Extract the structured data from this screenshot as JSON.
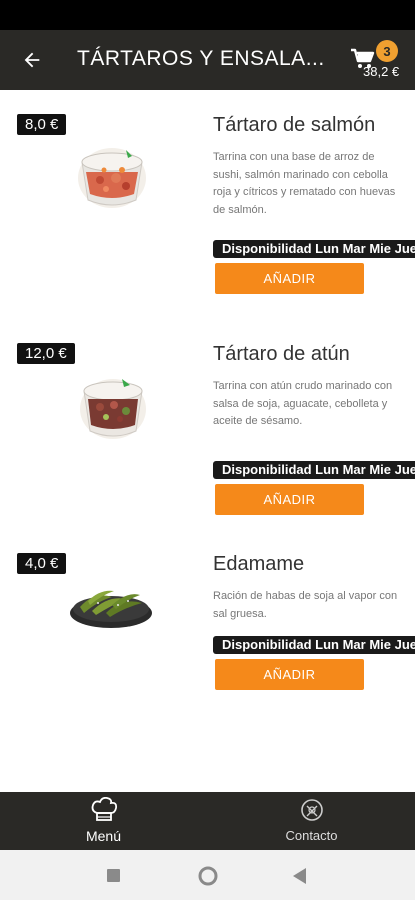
{
  "header": {
    "title": "TÁRTAROS Y ENSALA...",
    "cart_count": "3",
    "cart_total": "38,2 €"
  },
  "items": [
    {
      "price": "8,0 €",
      "name": "Tártaro de salmón",
      "description": "Tarrina con una base de arroz de sushi, salmón marinado con cebolla roja y cítricos y rematado con huevas de salmón.",
      "availability": "Disponibilidad Lun Mar Mie Jue Vie Sab Dom",
      "add_label": "AÑADIR"
    },
    {
      "price": "12,0 €",
      "name": "Tártaro de atún",
      "description": "Tarrina con atún crudo marinado con salsa de soja, aguacate, cebolleta y aceite de sésamo.",
      "availability": "Disponibilidad Lun Mar Mie Jue Vie Sab Dom",
      "add_label": "AÑADIR"
    },
    {
      "price": "4,0 €",
      "name": "Edamame",
      "description": "Ración de habas de soja al vapor con sal gruesa.",
      "availability": "Disponibilidad Lun Mar Mie Jue Vie Sab Dom",
      "add_label": "AÑADIR"
    }
  ],
  "bottom_nav": {
    "menu_label": "Menú",
    "contact_label": "Contacto"
  },
  "colors": {
    "bar_bg": "#2a2926",
    "accent": "#f5891a",
    "badge": "#f0a030"
  },
  "icons": {
    "back": "arrow-left-icon",
    "cart": "shopping-cart-icon",
    "menu": "chef-hat-icon",
    "contact": "contact-icon"
  }
}
